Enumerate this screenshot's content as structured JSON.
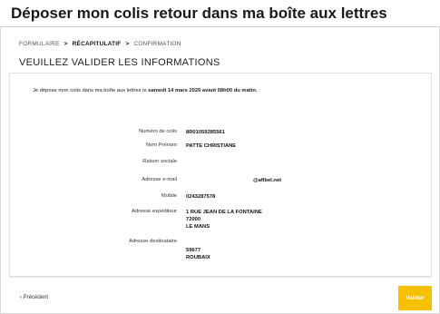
{
  "header": {
    "title": "Déposer mon colis retour dans ma boîte aux lettres"
  },
  "breadcrumb": {
    "step1": "FORMULAIRE",
    "step2": "RÉCAPITULATIF",
    "step3": "CONFIRMATION",
    "separator": ">"
  },
  "section_title": "VEUILLEZ VALIDER LES INFORMATIONS",
  "intro": {
    "prefix": "Je dépose mon colis dans ma boîte aux lettres le",
    "date": "samedi 14 mars 2020 avant 08h00 du matin."
  },
  "fields": [
    {
      "label": "Numéro de colis",
      "value": "8R01059285561"
    },
    {
      "label": "Nom Prénom",
      "value": "PATTE CHRISTIANE"
    },
    {
      "label": "Raison sociale",
      "value": ""
    },
    {
      "label": "Adresse e-mail",
      "value": "@afibel.net"
    },
    {
      "label": "Mobile",
      "value": "0243287578"
    },
    {
      "label": "Adresse expéditeur",
      "lines": [
        "1 RUE JEAN DE LA FONTAINE",
        "72000",
        "LE MANS"
      ]
    },
    {
      "label": "Adresse destinataire",
      "lines": [
        "59677",
        "ROUBAIX"
      ]
    }
  ],
  "footer": {
    "prev_label": "‹ Précédent",
    "submit_label": "Valider"
  },
  "colors": {
    "accent": "#f5c000"
  }
}
